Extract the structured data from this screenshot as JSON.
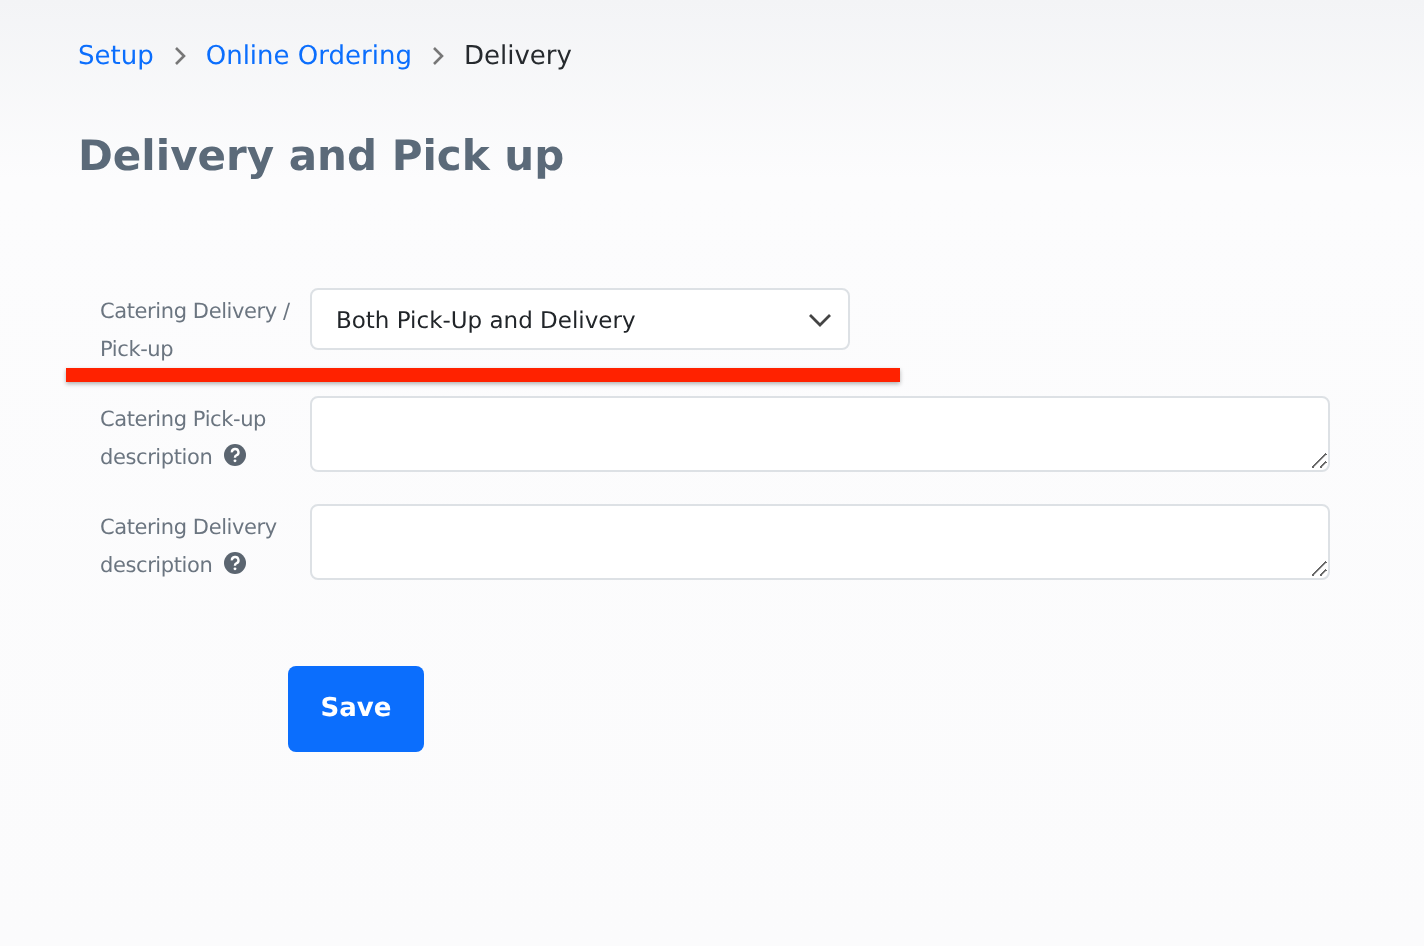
{
  "breadcrumb": [
    {
      "label": "Setup",
      "link": true
    },
    {
      "label": "Online Ordering",
      "link": true
    },
    {
      "label": "Delivery",
      "link": false
    }
  ],
  "title": "Delivery and Pick up",
  "fields": [
    {
      "kind": "select",
      "label": "Catering Delivery / Pick-up",
      "help": false,
      "value": "Both Pick-Up and Delivery"
    },
    {
      "kind": "textarea",
      "label": "Catering Pick-up description",
      "help": true
    },
    {
      "kind": "textarea",
      "label": "Catering Delivery description",
      "help": true
    }
  ],
  "save_button": "Save"
}
